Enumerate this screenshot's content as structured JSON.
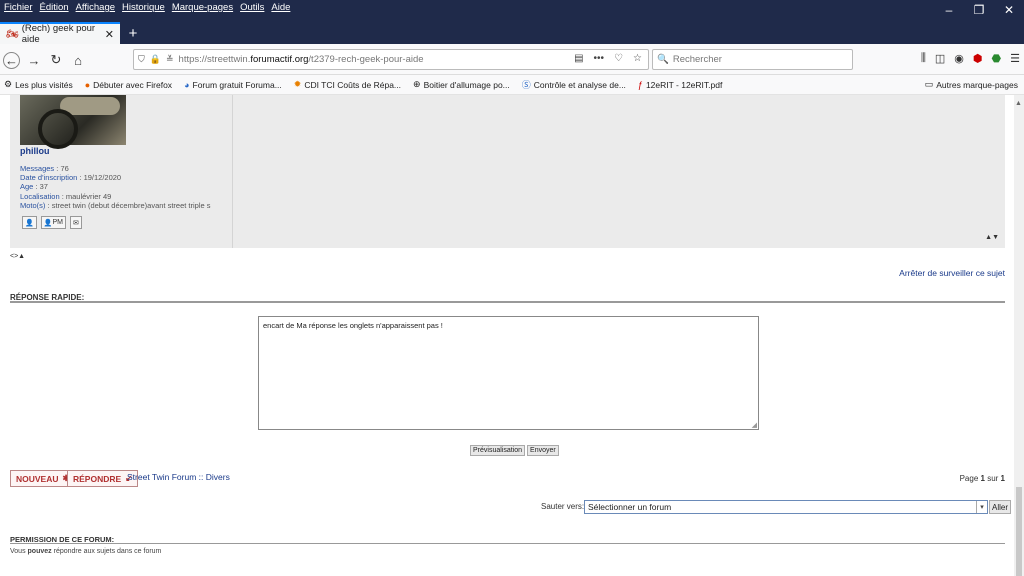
{
  "menu": [
    "Fichier",
    "Édition",
    "Affichage",
    "Historique",
    "Marque-pages",
    "Outils",
    "Aide"
  ],
  "tab": {
    "title": "(Rech) geek pour aide"
  },
  "url": {
    "prefix": "https://streettwin.",
    "domain": "forumactif.org",
    "path": "/t2379-rech-geek-pour-aide"
  },
  "search": {
    "placeholder": "Rechercher"
  },
  "bookmarks": [
    {
      "label": "Les plus visités",
      "icon": "gear-icon"
    },
    {
      "label": "Débuter avec Firefox",
      "icon": "firefox-icon"
    },
    {
      "label": "Forum gratuit Foruma...",
      "icon": "forum-icon"
    },
    {
      "label": "CDI TCI Coûts de Répa...",
      "icon": "cdi-icon"
    },
    {
      "label": "Boitier d'allumage po...",
      "icon": "globe-icon"
    },
    {
      "label": "Contrôle et analyse de...",
      "icon": "s-icon"
    },
    {
      "label": "12eRIT - 12eRIT.pdf",
      "icon": "pdf-icon"
    }
  ],
  "bookmarks_other": "Autres marque-pages",
  "post": {
    "username": "phillou",
    "messages_label": "Messages",
    "messages": "76",
    "inscription_label": "Date d'inscription",
    "inscription": "19/12/2020",
    "age_label": "Age",
    "age": "37",
    "localisation_label": "Localisation",
    "localisation": "maulévrier 49",
    "moto_label": "Moto(s)",
    "moto": "street twin (debut décembre)avant street triple s",
    "btn_pm": "PM",
    "btn_mail": "✉"
  },
  "stop_watch": "Arrêter de surveiller ce sujet",
  "quick_reply": {
    "title": "RÉPONSE RAPIDE:",
    "text": "encart de Ma réponse les onglets n'apparaissent pas !",
    "preview": "Prévisualisation",
    "send": "Envoyer"
  },
  "actions": {
    "new": "NOUVEAU",
    "reply": "RÉPONDRE"
  },
  "breadcrumb": "Street Twin Forum :: Divers",
  "pagination": {
    "prefix": "Page",
    "current": "1",
    "sep": "sur",
    "total": "1"
  },
  "jump": {
    "label": "Sauter vers:",
    "selected": "Sélectionner un forum",
    "go": "Aller"
  },
  "permission": {
    "title": "PERMISSION DE CE FORUM:",
    "pre": "Vous",
    "bold": "pouvez",
    "post": "répondre aux sujets dans ce forum"
  }
}
